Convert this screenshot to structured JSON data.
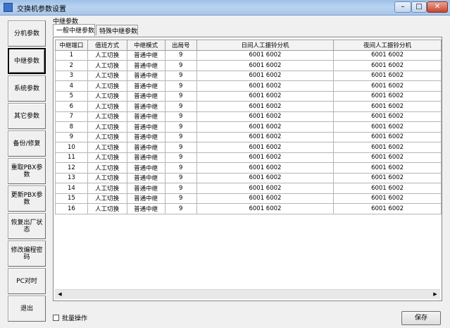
{
  "window": {
    "title": "交换机参数设置"
  },
  "nav": [
    {
      "label": "分机参数"
    },
    {
      "label": "中继参数",
      "active": true
    },
    {
      "label": "系统参数"
    },
    {
      "label": "其它参数"
    },
    {
      "label": "备份/修复"
    },
    {
      "label": "重取PBX参数"
    },
    {
      "label": "更新PBX参数"
    },
    {
      "label": "恢复出厂状态"
    },
    {
      "label": "修改编程密码"
    },
    {
      "label": "PC对时"
    },
    {
      "label": "退出"
    }
  ],
  "group": {
    "label": "中继参数"
  },
  "tabs": [
    {
      "label": "一般中继参数",
      "active": true
    },
    {
      "label": "特殊中继参数"
    }
  ],
  "table": {
    "columns": [
      "中继端口",
      "值班方式",
      "中继模式",
      "出局号",
      "日间人工振铃分机",
      "夜间人工振铃分机"
    ],
    "rows": [
      [
        "1",
        "人工切换",
        "普通中继",
        "9",
        "6001  6002",
        "6001  6002"
      ],
      [
        "2",
        "人工切换",
        "普通中继",
        "9",
        "6001  6002",
        "6001  6002"
      ],
      [
        "3",
        "人工切换",
        "普通中继",
        "9",
        "6001  6002",
        "6001  6002"
      ],
      [
        "4",
        "人工切换",
        "普通中继",
        "9",
        "6001  6002",
        "6001  6002"
      ],
      [
        "5",
        "人工切换",
        "普通中继",
        "9",
        "6001  6002",
        "6001  6002"
      ],
      [
        "6",
        "人工切换",
        "普通中继",
        "9",
        "6001  6002",
        "6001  6002"
      ],
      [
        "7",
        "人工切换",
        "普通中继",
        "9",
        "6001  6002",
        "6001  6002"
      ],
      [
        "8",
        "人工切换",
        "普通中继",
        "9",
        "6001  6002",
        "6001  6002"
      ],
      [
        "9",
        "人工切换",
        "普通中继",
        "9",
        "6001  6002",
        "6001  6002"
      ],
      [
        "10",
        "人工切换",
        "普通中继",
        "9",
        "6001  6002",
        "6001  6002"
      ],
      [
        "11",
        "人工切换",
        "普通中继",
        "9",
        "6001  6002",
        "6001  6002"
      ],
      [
        "12",
        "人工切换",
        "普通中继",
        "9",
        "6001  6002",
        "6001  6002"
      ],
      [
        "13",
        "人工切换",
        "普通中继",
        "9",
        "6001  6002",
        "6001  6002"
      ],
      [
        "14",
        "人工切换",
        "普通中继",
        "9",
        "6001  6002",
        "6001  6002"
      ],
      [
        "15",
        "人工切换",
        "普通中继",
        "9",
        "6001  6002",
        "6001  6002"
      ],
      [
        "16",
        "人工切换",
        "普通中继",
        "9",
        "6001  6002",
        "6001  6002"
      ]
    ]
  },
  "bottom": {
    "batch_label": "批量操作",
    "save_label": "保存"
  },
  "icons": {
    "minimize": "minimize-icon",
    "maximize": "maximize-icon",
    "close": "close-icon",
    "scroll_left": "arrow-left-icon",
    "scroll_right": "arrow-right-icon"
  }
}
